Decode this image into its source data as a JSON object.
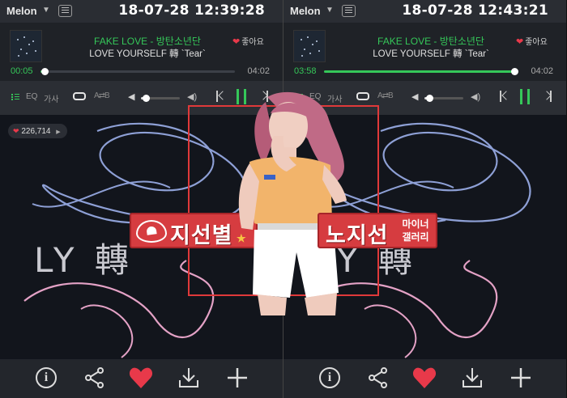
{
  "panels": [
    {
      "brand": "Melon",
      "timestamp": "18-07-28 12:39:28",
      "song_title": "FAKE LOVE - 방탄소년단",
      "album": "LOVE YOURSELF 轉 `Tear`",
      "like_label": "좋아요",
      "time_current": "00:05",
      "time_total": "04:02",
      "progress_fraction": 0.02,
      "eq_label": "EQ",
      "lyrics_label": "가사",
      "volume_fraction": 0.12,
      "likes_count": "226,714",
      "album_logo": "LY 轉"
    },
    {
      "brand": "Melon",
      "timestamp": "18-07-28 12:43:21",
      "song_title": "FAKE LOVE - 방탄소년단",
      "album": "LOVE YOURSELF 轉 `Tear`",
      "like_label": "좋아요",
      "time_current": "03:58",
      "time_total": "04:02",
      "progress_fraction": 0.98,
      "eq_label": "EQ",
      "lyrics_label": "가사",
      "volume_fraction": 0.12,
      "likes_count": "",
      "album_logo": "LY 轉"
    }
  ],
  "watermark": {
    "left_name": "지선별",
    "right_name": "노지선",
    "right_sub_1": "마이너",
    "right_sub_2": "갤러리"
  },
  "colors": {
    "accent_green": "#35c759",
    "heart_red": "#e8394a",
    "frame_red": "#e0393a",
    "sticker_red": "#d63c40"
  },
  "icons": [
    "chat-icon",
    "list-icon",
    "repeat-icon",
    "shuffle-icon",
    "volume-icon",
    "prev-icon",
    "pause-icon",
    "next-icon",
    "info-icon",
    "share-icon",
    "heart-icon",
    "download-icon",
    "add-icon"
  ]
}
